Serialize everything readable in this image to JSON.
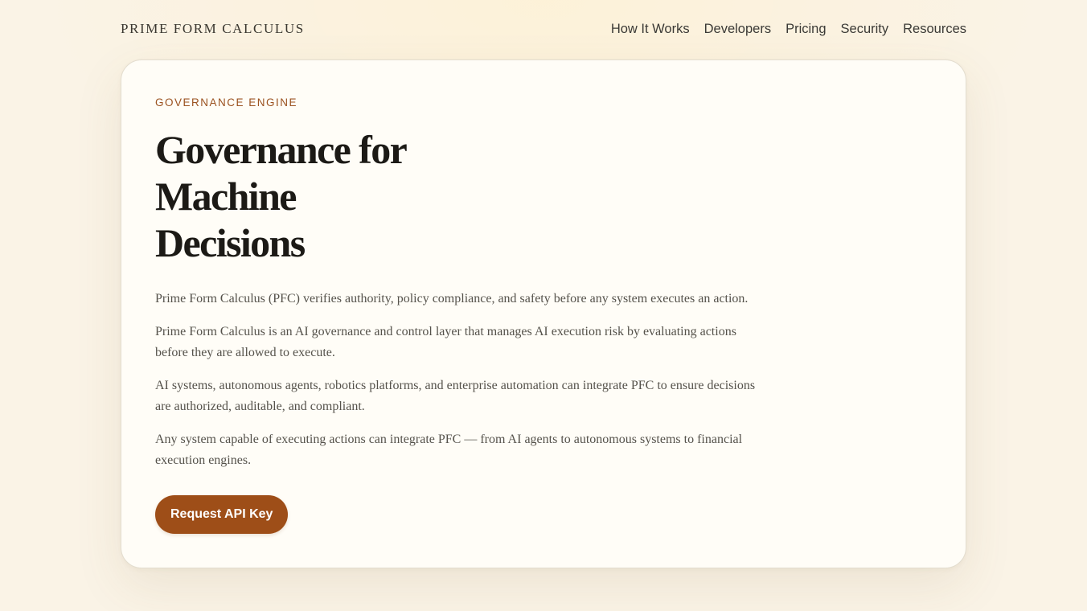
{
  "header": {
    "brand": "PRIME FORM CALCULUS",
    "nav": [
      {
        "label": "How It Works"
      },
      {
        "label": "Developers"
      },
      {
        "label": "Pricing"
      },
      {
        "label": "Security"
      },
      {
        "label": "Resources"
      }
    ]
  },
  "hero": {
    "eyebrow": "GOVERNANCE ENGINE",
    "headline_lines": [
      "Governance for",
      "Machine",
      "Decisions"
    ],
    "paragraphs": [
      "Prime Form Calculus (PFC) verifies authority, policy compliance, and safety before any system executes an action.",
      "Prime Form Calculus is an AI governance and control layer that manages AI execution risk by evaluating actions before they are allowed to execute.",
      "AI systems, autonomous agents, robotics platforms, and enterprise automation can integrate PFC to ensure decisions are authorized, auditable, and compliant.",
      "Any system capable of executing actions can integrate PFC — from AI agents to autonomous systems to financial execution engines."
    ],
    "cta_label": "Request API Key"
  },
  "colors": {
    "background": "#faf3e6",
    "card": "#fffdf7",
    "accent": "#9e4e18",
    "eyebrow": "#9b5220",
    "heading": "#1c1a16",
    "body_text": "#55524b"
  }
}
